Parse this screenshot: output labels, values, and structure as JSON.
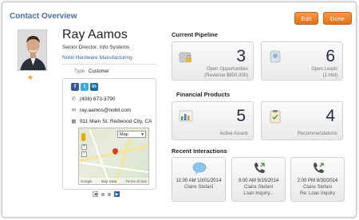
{
  "header": {
    "title": "Contact Overview",
    "edit_label": "Edit",
    "done_label": "Done"
  },
  "contact": {
    "name": "Ray Aamos",
    "role": "Senior Director, Info Systems",
    "company": "Nobil Hardware Manufacturing",
    "type_label": "Type",
    "type_value": "Customer",
    "phone": "(408) 673-3790",
    "email": "ray.aamos@nobil.com",
    "address": "911 Main St, Redwood City, CA",
    "social": [
      "f",
      "t",
      "in"
    ]
  },
  "map": {
    "type_option": "Map",
    "attribution": "Map Data",
    "terms": "Terms of Use",
    "logo": "Google"
  },
  "pipeline": {
    "title": "Current Pipeline",
    "opportunities": {
      "count": "3",
      "label": "Open Opportunities",
      "sub": "(Revenue $800,000)"
    },
    "leads": {
      "count": "6",
      "label": "Open Leads",
      "sub": "(1 Hot)"
    }
  },
  "financial": {
    "title": "Financial Products",
    "assets": {
      "count": "5",
      "label": "Active Assets"
    },
    "recommendations": {
      "count": "4",
      "label": "Recommendations"
    }
  },
  "interactions": {
    "title": "Recent Interactions",
    "items": [
      {
        "icon": "chat-bubble-icon",
        "line1": "11:00 AM 10/01/2014",
        "line2": "Claire Stefani",
        "line3": ""
      },
      {
        "icon": "phone-incoming-icon",
        "line1": "9:00 AM 9/15/2014",
        "line2": "Claire Stefani",
        "line3": "Loan Inquiry..."
      },
      {
        "icon": "phone-outgoing-icon",
        "line1": "2:00 PM 9/30/2014",
        "line2": "Claire Stefani",
        "line3": "Re: Loan Inquiry"
      }
    ]
  },
  "colors": {
    "accent": "#e97a22",
    "brand": "#4a6fa8",
    "number": "#1c2a44",
    "star": "#e7a21a"
  }
}
